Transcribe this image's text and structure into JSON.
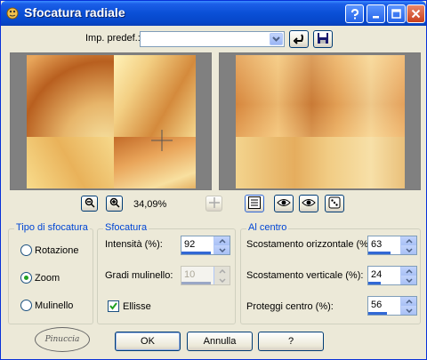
{
  "window": {
    "title": "Sfocatura radiale"
  },
  "preset": {
    "label": "Imp. predef.:",
    "value": ""
  },
  "zoom": {
    "level": "34,09%"
  },
  "blur_type": {
    "title": "Tipo di sfocatura",
    "options": [
      "Rotazione",
      "Zoom",
      "Mulinello"
    ],
    "selected": "Zoom"
  },
  "blur": {
    "title": "Sfocatura",
    "intensity_label": "Intensità (%):",
    "intensity_value": "92",
    "twirl_label": "Gradi mulinello:",
    "twirl_value": "10",
    "ellipse_label": "Ellisse",
    "ellipse_checked": true
  },
  "center": {
    "title": "Al centro",
    "h_offset_label": "Scostamento orizzontale (%):",
    "h_offset_value": "63",
    "v_offset_label": "Scostamento verticale (%):",
    "v_offset_value": "24",
    "protect_label": "Proteggi centro (%):",
    "protect_value": "56"
  },
  "buttons": {
    "ok": "OK",
    "cancel": "Annulla",
    "help": "?"
  },
  "logo": {
    "text": "Pinuccia"
  },
  "colors": {
    "title_bar": "#0a4fd6",
    "group_title": "#0046d5",
    "dialog_bg": "#ece9d8"
  }
}
